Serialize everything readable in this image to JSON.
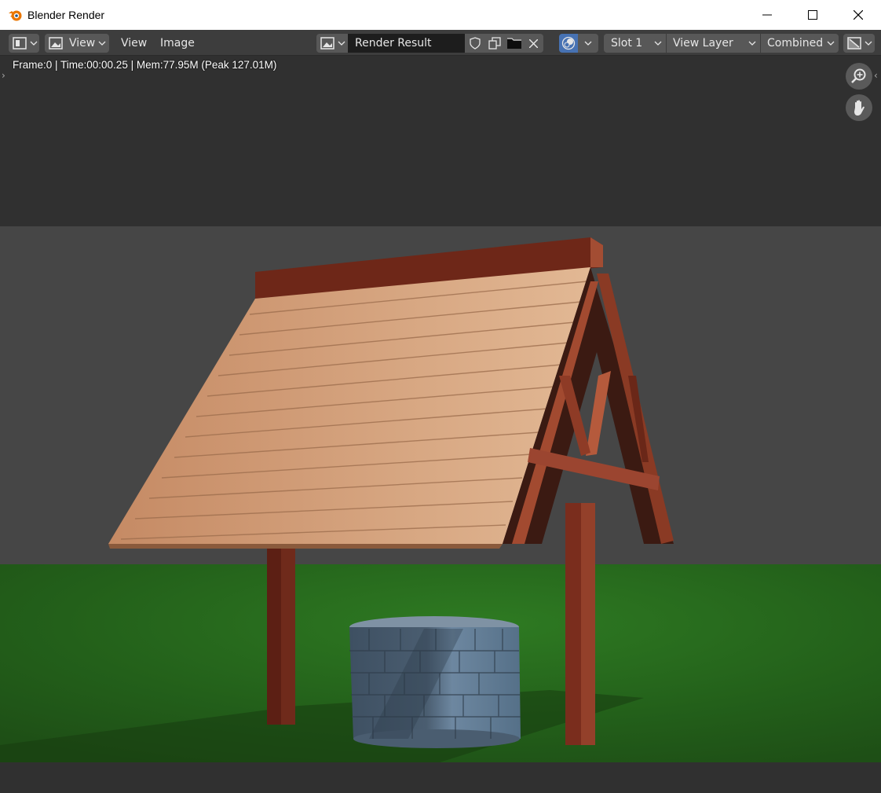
{
  "window": {
    "title": "Blender Render",
    "buttons": [
      "minimize",
      "maximize",
      "close"
    ]
  },
  "header": {
    "editor_type_icon": "image-editor-icon",
    "view_menu_icon": "image-icon",
    "view_dropdown_label": "View",
    "menus": [
      "View",
      "Image"
    ],
    "image_browse_icon": "image-browse-icon",
    "image_name": "Render Result",
    "fake_user_icon": "shield-icon",
    "duplicate_icon": "duplicate-icon",
    "open_icon": "folder-icon",
    "unlink_icon": "close-icon",
    "display_mode_icon": "display-channels-icon",
    "slot": "Slot 1",
    "view_layer": "View Layer",
    "pass": "Combined",
    "sample_icon": "sample-tool-icon"
  },
  "info_text": "Frame:0 | Time:00:00.25 | Mem:77.95M (Peak 127.01M)",
  "gizmos": [
    "zoom-icon",
    "hand-pan-icon"
  ],
  "colors": {
    "sky": "#464646",
    "ground": "#2e6b22",
    "roof": "#cf9f78",
    "wood": "#8a3a24",
    "stone": "#4e6378"
  }
}
